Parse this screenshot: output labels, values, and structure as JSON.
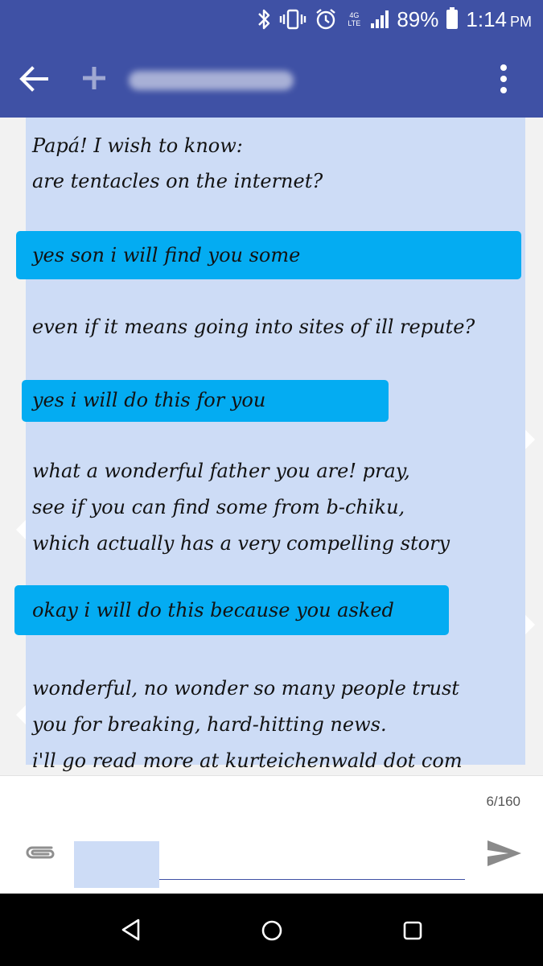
{
  "status_bar": {
    "battery_percent": "89%",
    "network": "4G LTE",
    "time": "1:14",
    "ampm": "PM",
    "icons": [
      "bluetooth-icon",
      "vibrate-icon",
      "alarm-icon",
      "network-4g-icon",
      "signal-icon",
      "battery-icon"
    ]
  },
  "app_bar": {
    "icons": [
      "back-arrow-icon",
      "add-contact-icon",
      "more-vert-icon"
    ],
    "accent_color": "#3f51a5"
  },
  "message": {
    "note_background": "#cddcf6",
    "highlight_color": "#04acf2",
    "lines": [
      "Papá! I wish to know:",
      "are tentacles on the internet?",
      "yes son i will find you some",
      "even if it means going into sites of ill repute?",
      "yes i will do this for you",
      "what a wonderful father you are! pray,",
      "see if you can find some from b-chiku,",
      "which actually has a very compelling story",
      "okay i will do this because you asked",
      "wonderful, no wonder so many people trust",
      "you for breaking, hard-hitting news.",
      "i'll go read more at kurteichenwald dot com"
    ]
  },
  "compose": {
    "char_counter": "6/160",
    "input_value": "",
    "icons": [
      "attach-icon",
      "send-icon"
    ]
  },
  "nav_bar": {
    "icons": [
      "nav-back-icon",
      "nav-home-icon",
      "nav-recents-icon"
    ]
  }
}
